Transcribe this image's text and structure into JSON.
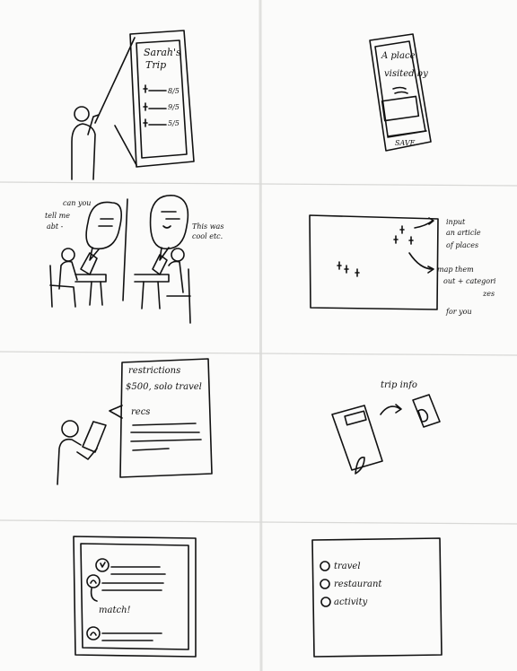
{
  "panels": {
    "p1": {
      "title_line1": "Sarah's",
      "title_line2": "Trip",
      "dates": [
        "8/5",
        "9/5",
        "5/5"
      ]
    },
    "p2": {
      "line1": "A place",
      "line2": "visited by",
      "button": "SAVE"
    },
    "p3": {
      "bubble_left_1": "can you",
      "bubble_left_2": "tell me",
      "bubble_left_3": "abt -",
      "bubble_right_1": "This was",
      "bubble_right_2": "cool etc."
    },
    "p4": {
      "note1_1": "input",
      "note1_2": "an article",
      "note1_3": "of places",
      "note2_1": "map them",
      "note2_2": "out + categori",
      "note2_3": "zes",
      "note2_4": "for you"
    },
    "p5": {
      "line1": "restrictions",
      "line2": "$500, solo travel",
      "line3": "recs"
    },
    "p6": {
      "label": "trip info"
    },
    "p7": {
      "label": "match!"
    },
    "p8": {
      "items": [
        "travel",
        "restaurant",
        "activity"
      ]
    }
  }
}
